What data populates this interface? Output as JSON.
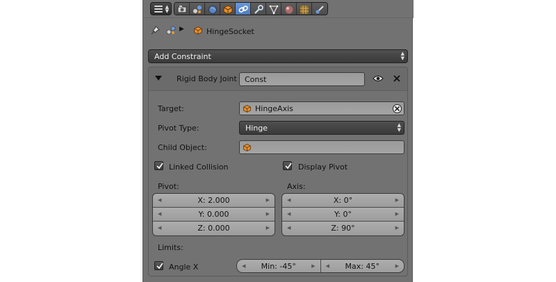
{
  "breadcrumb": {
    "object_name": "HingeSocket"
  },
  "add_constraint": {
    "label": "Add Constraint"
  },
  "constraint": {
    "type_label": "Rigid Body Joint",
    "name": "Const",
    "target": {
      "label": "Target:",
      "value": "HingeAxis"
    },
    "pivot_type": {
      "label": "Pivot Type:",
      "value": "Hinge"
    },
    "child_object": {
      "label": "Child Object:",
      "value": ""
    },
    "linked_collision": {
      "label": "Linked Collision",
      "checked": true
    },
    "display_pivot": {
      "label": "Display Pivot",
      "checked": true
    },
    "pivot": {
      "label": "Pivot:",
      "x": "X: 2.000",
      "y": "Y: 0.000",
      "z": "Z: 0.000"
    },
    "axis": {
      "label": "Axis:",
      "x": "X: 0°",
      "y": "Y: 0°",
      "z": "Z: 90°"
    },
    "limits": {
      "label": "Limits:",
      "angle_x": {
        "label": "Angle X",
        "checked": true
      },
      "min": "Min: -45°",
      "max": "Max: 45°"
    }
  },
  "colors": {
    "panel_bg": "#727272",
    "active_tab": "#5a88cc",
    "cube": "#e8902a"
  },
  "toolbar": {
    "tabs": [
      "render-icon",
      "scene-icon",
      "world-icon",
      "object-icon",
      "constraints-icon",
      "modifiers-icon",
      "data-icon",
      "material-icon",
      "texture-icon",
      "physics-icon"
    ],
    "active_tab": "constraints-icon"
  }
}
